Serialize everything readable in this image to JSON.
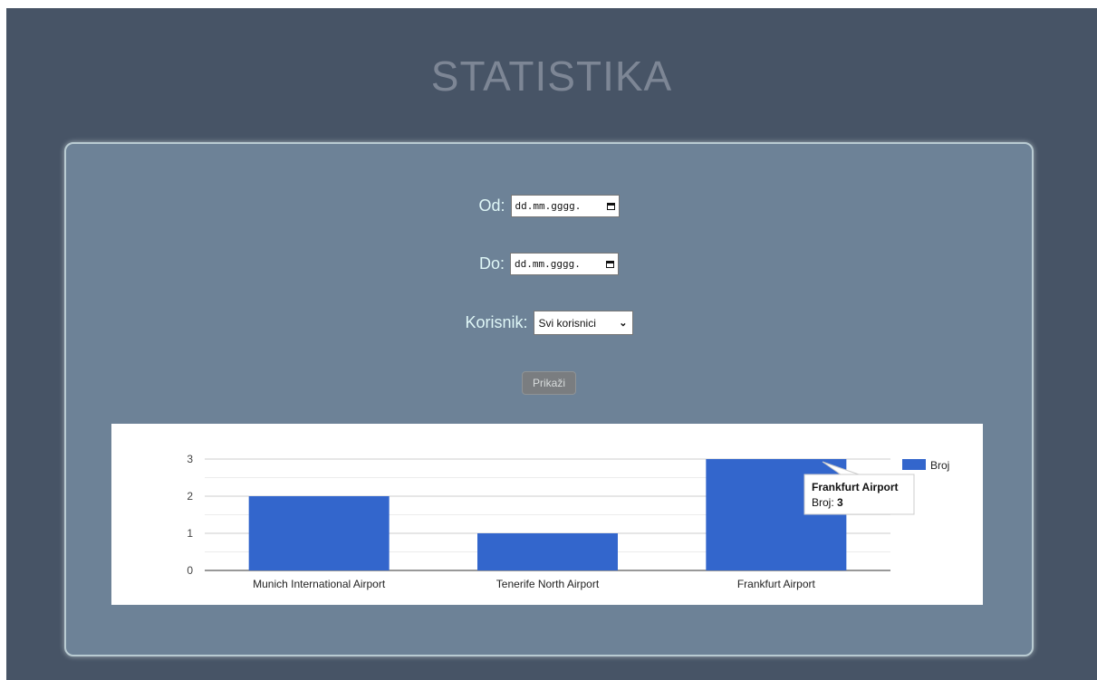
{
  "title": "STATISTIKA",
  "form": {
    "from_label": "Od:",
    "from_placeholder": "dd.mm.gggg.",
    "to_label": "Do:",
    "to_placeholder": "dd.mm.gggg.",
    "user_label": "Korisnik:",
    "user_selected": "Svi korisnici",
    "submit_label": "Prikaži"
  },
  "chart_data": {
    "type": "bar",
    "categories": [
      "Munich International Airport",
      "Tenerife North Airport",
      "Frankfurt Airport"
    ],
    "series": [
      {
        "name": "Broj",
        "values": [
          2,
          1,
          3
        ],
        "color": "#3366cc"
      }
    ],
    "yticks": [
      0,
      1,
      2,
      3
    ],
    "ylim": [
      0,
      3
    ],
    "grid": true,
    "legend": "right",
    "tooltip": {
      "title": "Frankfurt Airport",
      "label": "Broj:",
      "value": "3"
    }
  },
  "colors": {
    "background": "#475466",
    "panel": "#6d8297",
    "bar": "#3366cc"
  }
}
